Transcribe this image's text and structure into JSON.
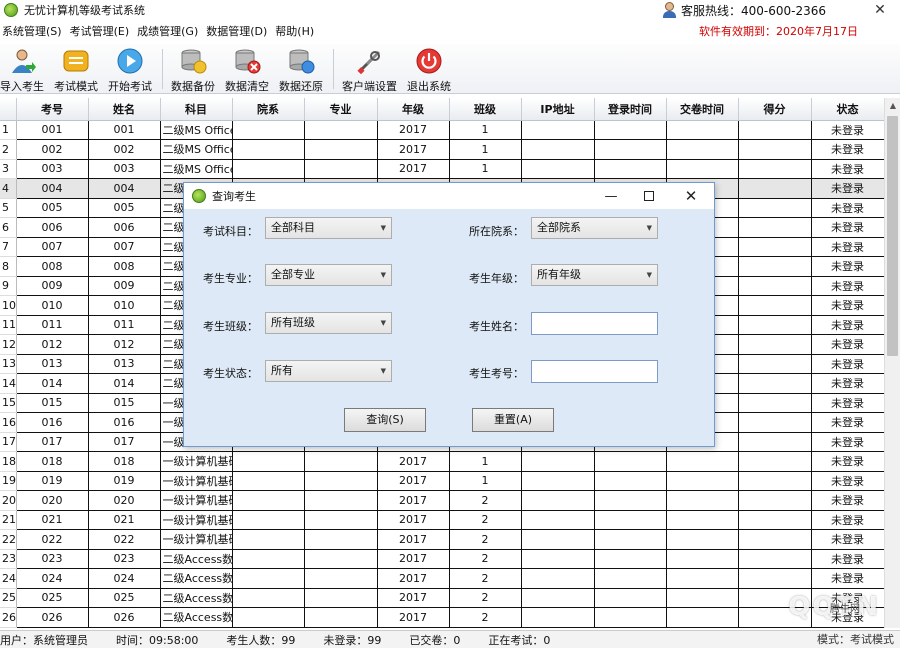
{
  "app": {
    "title": "无忧计算机等级考试系统",
    "hotline": "客服热线：400-600-2366",
    "close_glyph": "✕",
    "expiry": "软件有效期到：2020年7月17日"
  },
  "menu": [
    "系统管理(S)",
    "考试管理(E)",
    "成绩管理(G)",
    "数据管理(D)",
    "帮助(H)"
  ],
  "toolbar": [
    {
      "label": "导入考生",
      "icon": "import-students-icon"
    },
    {
      "label": "考试模式",
      "icon": "exam-mode-icon"
    },
    {
      "label": "开始考试",
      "icon": "start-exam-icon"
    },
    {
      "label": "数据备份",
      "icon": "data-backup-icon"
    },
    {
      "label": "数据清空",
      "icon": "data-clear-icon"
    },
    {
      "label": "数据还原",
      "icon": "data-restore-icon"
    },
    {
      "label": "客户端设置",
      "icon": "client-settings-icon"
    },
    {
      "label": "退出系统",
      "icon": "exit-system-icon"
    }
  ],
  "grid": {
    "columns": [
      "",
      "考号",
      "姓名",
      "科目",
      "院系",
      "专业",
      "年级",
      "班级",
      "IP地址",
      "登录时间",
      "交卷时间",
      "得分",
      "状态"
    ],
    "rows": [
      [
        "1",
        "001",
        "001",
        "二级MS Office",
        "",
        "",
        "2017",
        "1",
        "",
        "",
        "",
        "",
        "未登录"
      ],
      [
        "2",
        "002",
        "002",
        "二级MS Office",
        "",
        "",
        "2017",
        "1",
        "",
        "",
        "",
        "",
        "未登录"
      ],
      [
        "3",
        "003",
        "003",
        "二级MS Office",
        "",
        "",
        "2017",
        "1",
        "",
        "",
        "",
        "",
        "未登录"
      ],
      [
        "4",
        "004",
        "004",
        "二级",
        "",
        "",
        "",
        "",
        "",
        "",
        "",
        "",
        "未登录"
      ],
      [
        "5",
        "005",
        "005",
        "二级",
        "",
        "",
        "",
        "",
        "",
        "",
        "",
        "",
        "未登录"
      ],
      [
        "6",
        "006",
        "006",
        "二级",
        "",
        "",
        "",
        "",
        "",
        "",
        "",
        "",
        "未登录"
      ],
      [
        "7",
        "007",
        "007",
        "二级",
        "",
        "",
        "",
        "",
        "",
        "",
        "",
        "",
        "未登录"
      ],
      [
        "8",
        "008",
        "008",
        "二级",
        "",
        "",
        "",
        "",
        "",
        "",
        "",
        "",
        "未登录"
      ],
      [
        "9",
        "009",
        "009",
        "二级",
        "",
        "",
        "",
        "",
        "",
        "",
        "",
        "",
        "未登录"
      ],
      [
        "10",
        "010",
        "010",
        "二级",
        "",
        "",
        "",
        "",
        "",
        "",
        "",
        "",
        "未登录"
      ],
      [
        "11",
        "011",
        "011",
        "二级",
        "",
        "",
        "",
        "",
        "",
        "",
        "",
        "",
        "未登录"
      ],
      [
        "12",
        "012",
        "012",
        "二级",
        "",
        "",
        "",
        "",
        "",
        "",
        "",
        "",
        "未登录"
      ],
      [
        "13",
        "013",
        "013",
        "二级",
        "",
        "",
        "",
        "",
        "",
        "",
        "",
        "",
        "未登录"
      ],
      [
        "14",
        "014",
        "014",
        "二级",
        "",
        "",
        "",
        "",
        "",
        "",
        "",
        "",
        "未登录"
      ],
      [
        "15",
        "015",
        "015",
        "一级",
        "",
        "",
        "",
        "",
        "",
        "",
        "",
        "",
        "未登录"
      ],
      [
        "16",
        "016",
        "016",
        "一级",
        "",
        "",
        "",
        "",
        "",
        "",
        "",
        "",
        "未登录"
      ],
      [
        "17",
        "017",
        "017",
        "一级",
        "",
        "",
        "",
        "",
        "",
        "",
        "",
        "",
        "未登录"
      ],
      [
        "18",
        "018",
        "018",
        "一级计算机基础",
        "",
        "",
        "2017",
        "1",
        "",
        "",
        "",
        "",
        "未登录"
      ],
      [
        "19",
        "019",
        "019",
        "一级计算机基础",
        "",
        "",
        "2017",
        "1",
        "",
        "",
        "",
        "",
        "未登录"
      ],
      [
        "20",
        "020",
        "020",
        "一级计算机基础",
        "",
        "",
        "2017",
        "2",
        "",
        "",
        "",
        "",
        "未登录"
      ],
      [
        "21",
        "021",
        "021",
        "一级计算机基础",
        "",
        "",
        "2017",
        "2",
        "",
        "",
        "",
        "",
        "未登录"
      ],
      [
        "22",
        "022",
        "022",
        "一级计算机基础",
        "",
        "",
        "2017",
        "2",
        "",
        "",
        "",
        "",
        "未登录"
      ],
      [
        "23",
        "023",
        "023",
        "二级Access数据库",
        "",
        "",
        "2017",
        "2",
        "",
        "",
        "",
        "",
        "未登录"
      ],
      [
        "24",
        "024",
        "024",
        "二级Access数据库",
        "",
        "",
        "2017",
        "2",
        "",
        "",
        "",
        "",
        "未登录"
      ],
      [
        "25",
        "025",
        "025",
        "二级Access数据库",
        "",
        "",
        "2017",
        "2",
        "",
        "",
        "",
        "",
        "未登录"
      ],
      [
        "26",
        "026",
        "026",
        "二级Access数据库",
        "",
        "",
        "2017",
        "2",
        "",
        "",
        "",
        "",
        "未登录"
      ]
    ]
  },
  "status": {
    "user": "用户：系统管理员",
    "time": "时间：09:58:00",
    "total": "考生人数：99",
    "not_logged": "未登录：99",
    "submitted": "已交卷：0",
    "testing": "正在考试：0",
    "mode": "模式：考试模式"
  },
  "dialog": {
    "title": "查询考生",
    "min_glyph": "—",
    "close_glyph": "✕",
    "fields": {
      "subject": {
        "label": "考试科目：",
        "value": "全部科目"
      },
      "department": {
        "label": "所在院系：",
        "value": "全部院系"
      },
      "major": {
        "label": "考生专业：",
        "value": "全部专业"
      },
      "grade": {
        "label": "考生年级：",
        "value": "所有年级"
      },
      "class": {
        "label": "考生班级：",
        "value": "所有班级"
      },
      "name": {
        "label": "考生姓名：",
        "value": ""
      },
      "state": {
        "label": "考生状态：",
        "value": "所有"
      },
      "id": {
        "label": "考生考号：",
        "value": ""
      }
    },
    "query_button": "查询(S)",
    "reset_button": "重置(A)"
  },
  "watermark": {
    "text": "QQTN",
    "sub": "腾牛网"
  }
}
